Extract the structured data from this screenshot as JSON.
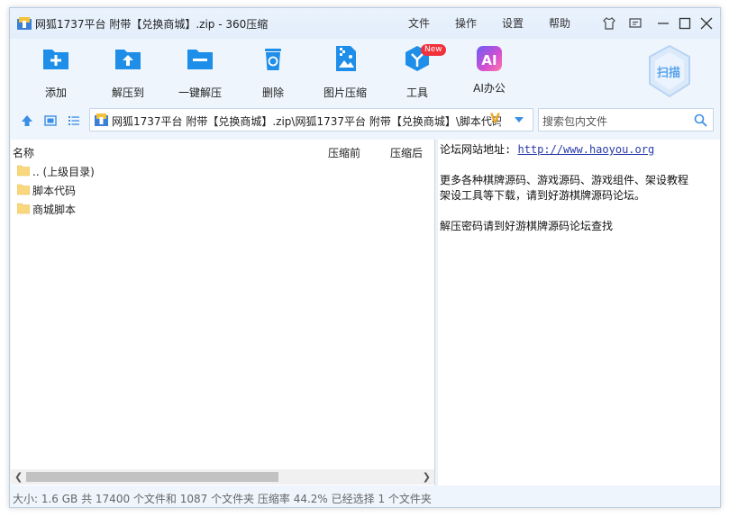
{
  "window": {
    "title": "网狐1737平台 附带【兑换商城】.zip - 360压缩",
    "menu": {
      "file": "文件",
      "operate": "操作",
      "settings": "设置",
      "help": "帮助"
    }
  },
  "toolbar": {
    "add": "添加",
    "extract_to": "解压到",
    "one_click_extract": "一键解压",
    "delete": "删除",
    "image_compress": "图片压缩",
    "tools": "工具",
    "tools_badge": "New",
    "ai_office": "AI办公",
    "ai_icon_text": "AI",
    "scan": "扫描"
  },
  "address": {
    "path": "网狐1737平台 附带【兑换商城】.zip\\网狐1737平台 附带【兑换商城】\\脚本代码",
    "badge": "V"
  },
  "search": {
    "placeholder": "搜索包内文件"
  },
  "file_list": {
    "columns": {
      "name": "名称",
      "before": "压缩前",
      "after": "压缩后"
    },
    "rows": [
      {
        "name": ".. (上级目录)"
      },
      {
        "name": "脚本代码"
      },
      {
        "name": "商城脚本"
      }
    ]
  },
  "preview": {
    "site_label": "论坛网站地址:",
    "site_url": "http://www.haoyou.org",
    "line2": "更多各种棋牌源码、游戏源码、游戏组件、架设教程",
    "line3": "架设工具等下载，请到好游棋牌源码论坛。",
    "line4": "解压密码请到好游棋牌源码论坛查找"
  },
  "status": {
    "text": "大小: 1.6 GB 共 17400 个文件和 1087 个文件夹 压缩率 44.2% 已经选择 1 个文件夹"
  },
  "colors": {
    "accent": "#1e8ee8",
    "folder": "#f9d77e",
    "window_bg": "#eef5fc"
  }
}
